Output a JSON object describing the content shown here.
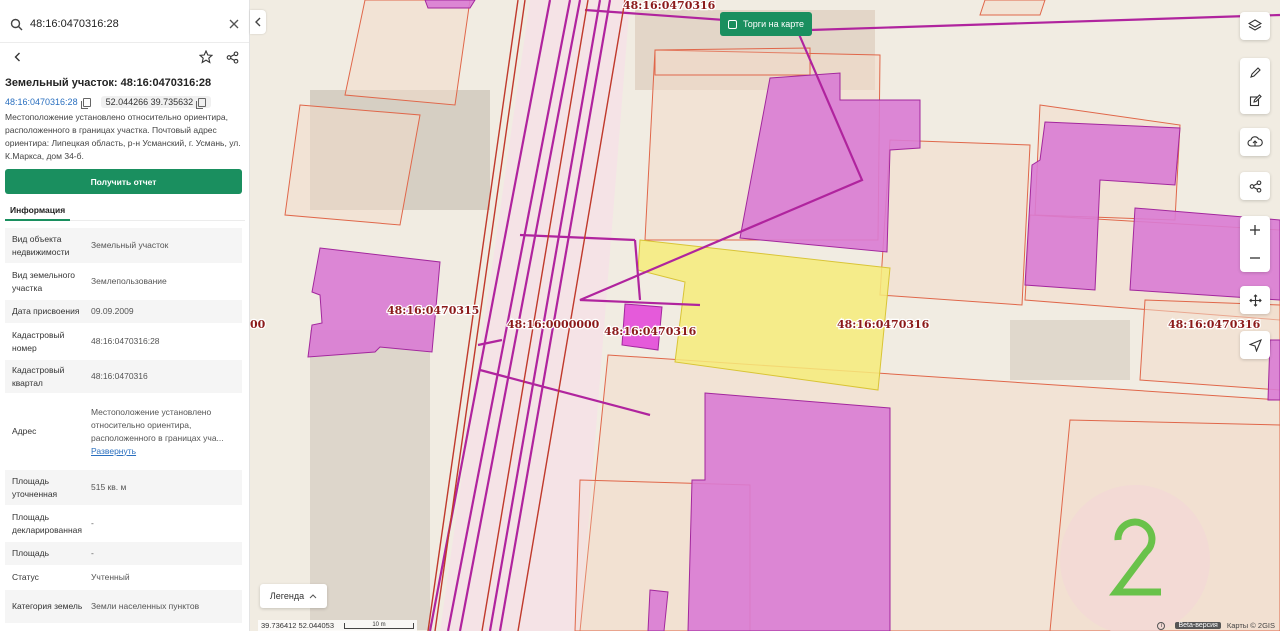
{
  "search": {
    "value": "48:16:0470316:28"
  },
  "panel": {
    "title": "Земельный участок: 48:16:0470316:28",
    "cadastral_link": "48:16:0470316:28",
    "coordinates": "52.044266 39.735632",
    "location": "Местоположение установлено относительно ориентира, расположенного в границах участка. Почтовый адрес ориентира: Липецкая область, р-н Усманский, г. Усмань, ул. К.Маркса, дом 34-б.",
    "report_button": "Получить отчет",
    "tab_info": "Информация"
  },
  "info": {
    "rows": [
      {
        "key": "Вид объекта недвижимости",
        "value": "Земельный участок"
      },
      {
        "key": "Вид земельного участка",
        "value": "Землепользование"
      },
      {
        "key": "Дата присвоения",
        "value": "09.09.2009"
      },
      {
        "key": "Кадастровый номер",
        "value": "48:16:0470316:28"
      },
      {
        "key": "Кадастровый квартал",
        "value": "48:16:0470316"
      },
      {
        "key": "Адрес",
        "value": "Местоположение установлено относительно ориентира, расположенного в границах уча..."
      },
      {
        "key": "Площадь уточненная",
        "value": "515 кв. м"
      },
      {
        "key": "Площадь декларированная",
        "value": "-"
      },
      {
        "key": "Площадь",
        "value": "-"
      },
      {
        "key": "Статус",
        "value": "Учтенный"
      },
      {
        "key": "Категория земель",
        "value": "Земли населенных пунктов"
      }
    ],
    "expand_link": "Развернуть"
  },
  "map": {
    "auction_toggle": "Торги на карте",
    "legend": "Легенда",
    "cursor_coords": "39.736412  52.044053",
    "scale": "10 m",
    "beta": "Beta-версия",
    "attribution": "Карты © 2GIS",
    "labels": [
      "48:16:0470316",
      "48:16:0470315",
      "48:16:0000000",
      "48:16:0470316",
      "48:16:0470316",
      "48:16:0470316",
      "00"
    ],
    "colors": {
      "selected_fill": "#f6ec7a",
      "building_fill": "#d97bd4",
      "parcel_border": "#e0674a",
      "line": "#b0249e"
    }
  }
}
